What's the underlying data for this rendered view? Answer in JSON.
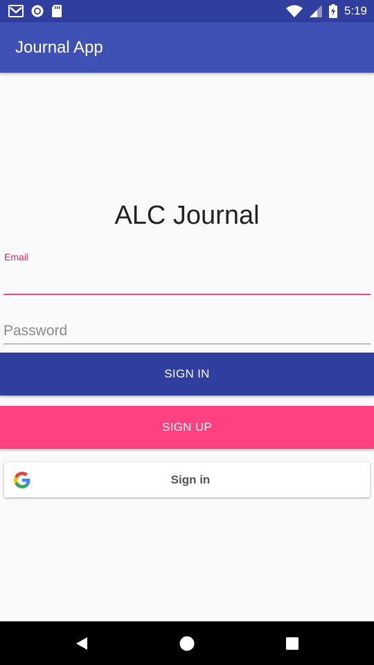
{
  "status_bar": {
    "time": "5:19",
    "left_icons": [
      "gmail-icon",
      "sync-circle-icon",
      "sd-card-icon"
    ],
    "right_icons": [
      "wifi-icon",
      "signal-icon",
      "battery-charging-icon"
    ]
  },
  "app_bar": {
    "title": "Journal App",
    "color": "#3f51b5"
  },
  "heading": "ALC Journal",
  "form": {
    "email_label": "Email",
    "email_value": "",
    "password_placeholder": "Password",
    "accent_color": "#ff4081"
  },
  "buttons": {
    "sign_in": "SIGN IN",
    "sign_up": "SIGN UP",
    "google_sign_in": "Sign in"
  },
  "colors": {
    "primary": "#3f51b5",
    "primary_dark": "#303f9f",
    "accent": "#ff4081"
  },
  "nav_bar": {
    "icons": [
      "back-icon",
      "home-icon",
      "recents-icon"
    ]
  }
}
